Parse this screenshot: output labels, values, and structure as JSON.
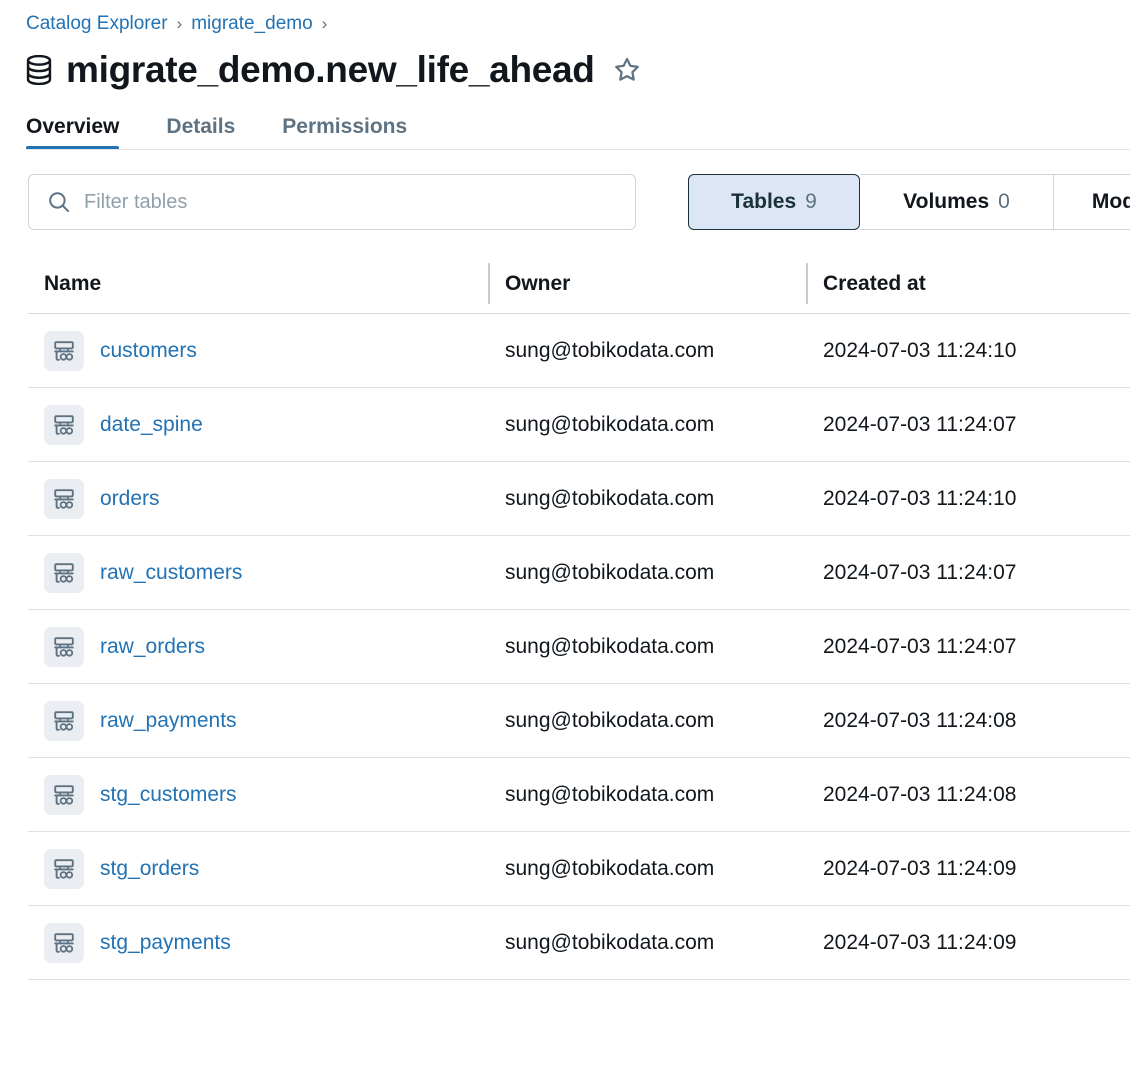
{
  "breadcrumb": {
    "items": [
      {
        "label": "Catalog Explorer"
      },
      {
        "label": "migrate_demo"
      }
    ],
    "separator": "›"
  },
  "header": {
    "icon": "database-icon",
    "title": "migrate_demo.new_life_ahead",
    "favorite_icon": "star-outline-icon",
    "favorited": false
  },
  "tabs": [
    {
      "label": "Overview",
      "active": true
    },
    {
      "label": "Details",
      "active": false
    },
    {
      "label": "Permissions",
      "active": false
    }
  ],
  "search": {
    "icon": "search-icon",
    "placeholder": "Filter tables",
    "value": ""
  },
  "segmented_control": [
    {
      "label": "Tables",
      "count": "9",
      "selected": true
    },
    {
      "label": "Volumes",
      "count": "0",
      "selected": false
    },
    {
      "label": "Mod",
      "count": "",
      "selected": false,
      "truncated": true
    }
  ],
  "table": {
    "columns": [
      {
        "key": "name",
        "label": "Name"
      },
      {
        "key": "owner",
        "label": "Owner"
      },
      {
        "key": "created_at",
        "label": "Created at"
      }
    ],
    "row_icon": "table-icon",
    "rows": [
      {
        "name": "customers",
        "owner": "sung@tobikodata.com",
        "created_at": "2024-07-03 11:24:10"
      },
      {
        "name": "date_spine",
        "owner": "sung@tobikodata.com",
        "created_at": "2024-07-03 11:24:07"
      },
      {
        "name": "orders",
        "owner": "sung@tobikodata.com",
        "created_at": "2024-07-03 11:24:10"
      },
      {
        "name": "raw_customers",
        "owner": "sung@tobikodata.com",
        "created_at": "2024-07-03 11:24:07"
      },
      {
        "name": "raw_orders",
        "owner": "sung@tobikodata.com",
        "created_at": "2024-07-03 11:24:07"
      },
      {
        "name": "raw_payments",
        "owner": "sung@tobikodata.com",
        "created_at": "2024-07-03 11:24:08"
      },
      {
        "name": "stg_customers",
        "owner": "sung@tobikodata.com",
        "created_at": "2024-07-03 11:24:08"
      },
      {
        "name": "stg_orders",
        "owner": "sung@tobikodata.com",
        "created_at": "2024-07-03 11:24:09"
      },
      {
        "name": "stg_payments",
        "owner": "sung@tobikodata.com",
        "created_at": "2024-07-03 11:24:09"
      }
    ]
  },
  "colors": {
    "link": "#2272b4",
    "accent": "#2272b4",
    "text": "#11171c",
    "muted": "#5f7281",
    "selected_segment_bg": "#dce6f4",
    "selected_segment_border": "#1b3139",
    "border": "#cdd4dc",
    "icon_chip_bg": "#eaedf1"
  }
}
